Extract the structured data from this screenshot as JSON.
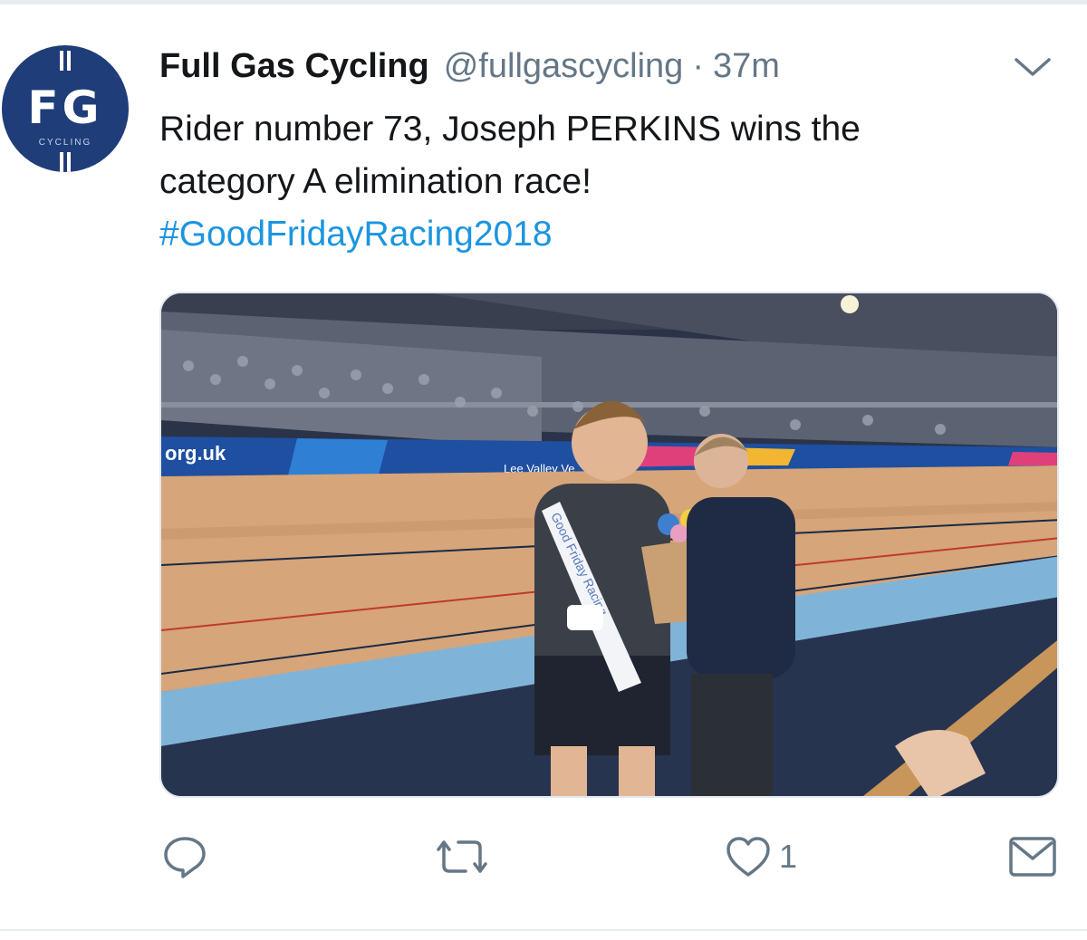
{
  "tweet": {
    "author_name": "Full Gas Cycling",
    "author_handle": "@fullgascycling",
    "separator": "·",
    "timestamp": "37m",
    "text_line_1": "Rider number 73, Joseph PERKINS wins the",
    "text_line_2": "category A elimination race!",
    "hashtag": "#GoodFridayRacing2018"
  },
  "avatar": {
    "logo_text": "FG",
    "logo_sub": "CYCLING",
    "color": "#1f3d78"
  },
  "media": {
    "banner_text_1": "org.uk",
    "banner_text_2": "Lee Valley Ve",
    "sash_text": "Good Friday Racing"
  },
  "actions": {
    "reply_icon": "reply-icon",
    "retweet_icon": "retweet-icon",
    "like_icon": "heart-icon",
    "like_count": "1",
    "dm_icon": "envelope-icon"
  },
  "colors": {
    "link": "#1b95e0",
    "secondary_text": "#657786",
    "primary_text": "#14171a"
  }
}
